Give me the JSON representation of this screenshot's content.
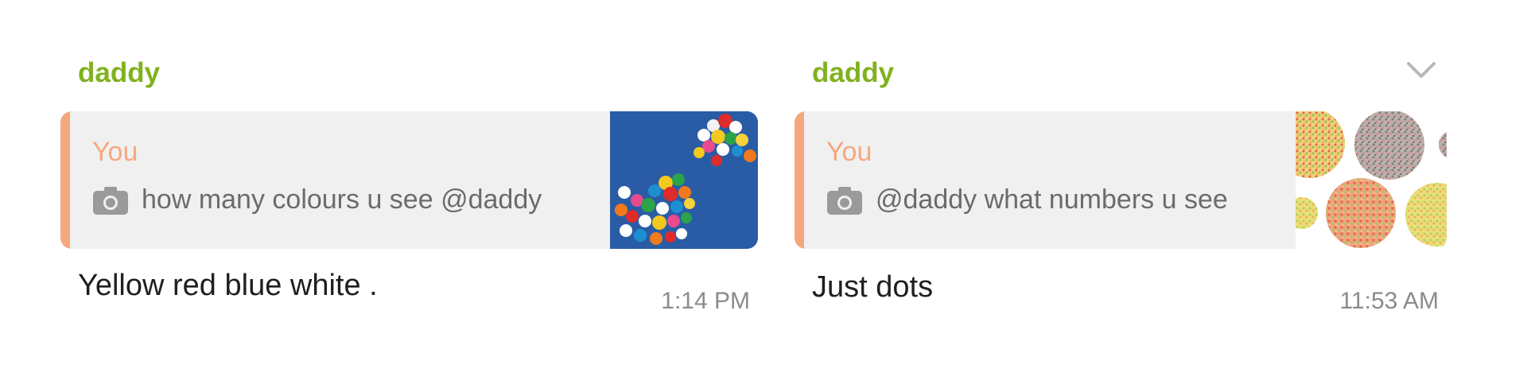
{
  "messages": [
    {
      "sender": "daddy",
      "quote": {
        "author": "You",
        "text": "how many colours u see @daddy",
        "icon": "camera-icon"
      },
      "body": "Yellow red blue white .",
      "time": "1:14 PM"
    },
    {
      "sender": "daddy",
      "quote": {
        "author": "You",
        "text": "@daddy what numbers u see",
        "icon": "camera-icon"
      },
      "body": "Just dots",
      "time": "11:53 AM",
      "menu_icon": "chevron-down-icon"
    }
  ],
  "colors": {
    "sender": "#7fb21e",
    "quote_accent": "#f7a77e",
    "quote_bg": "#f0f0f0",
    "body_text": "#1f1f1f",
    "timestamp": "#8b8b8b"
  }
}
